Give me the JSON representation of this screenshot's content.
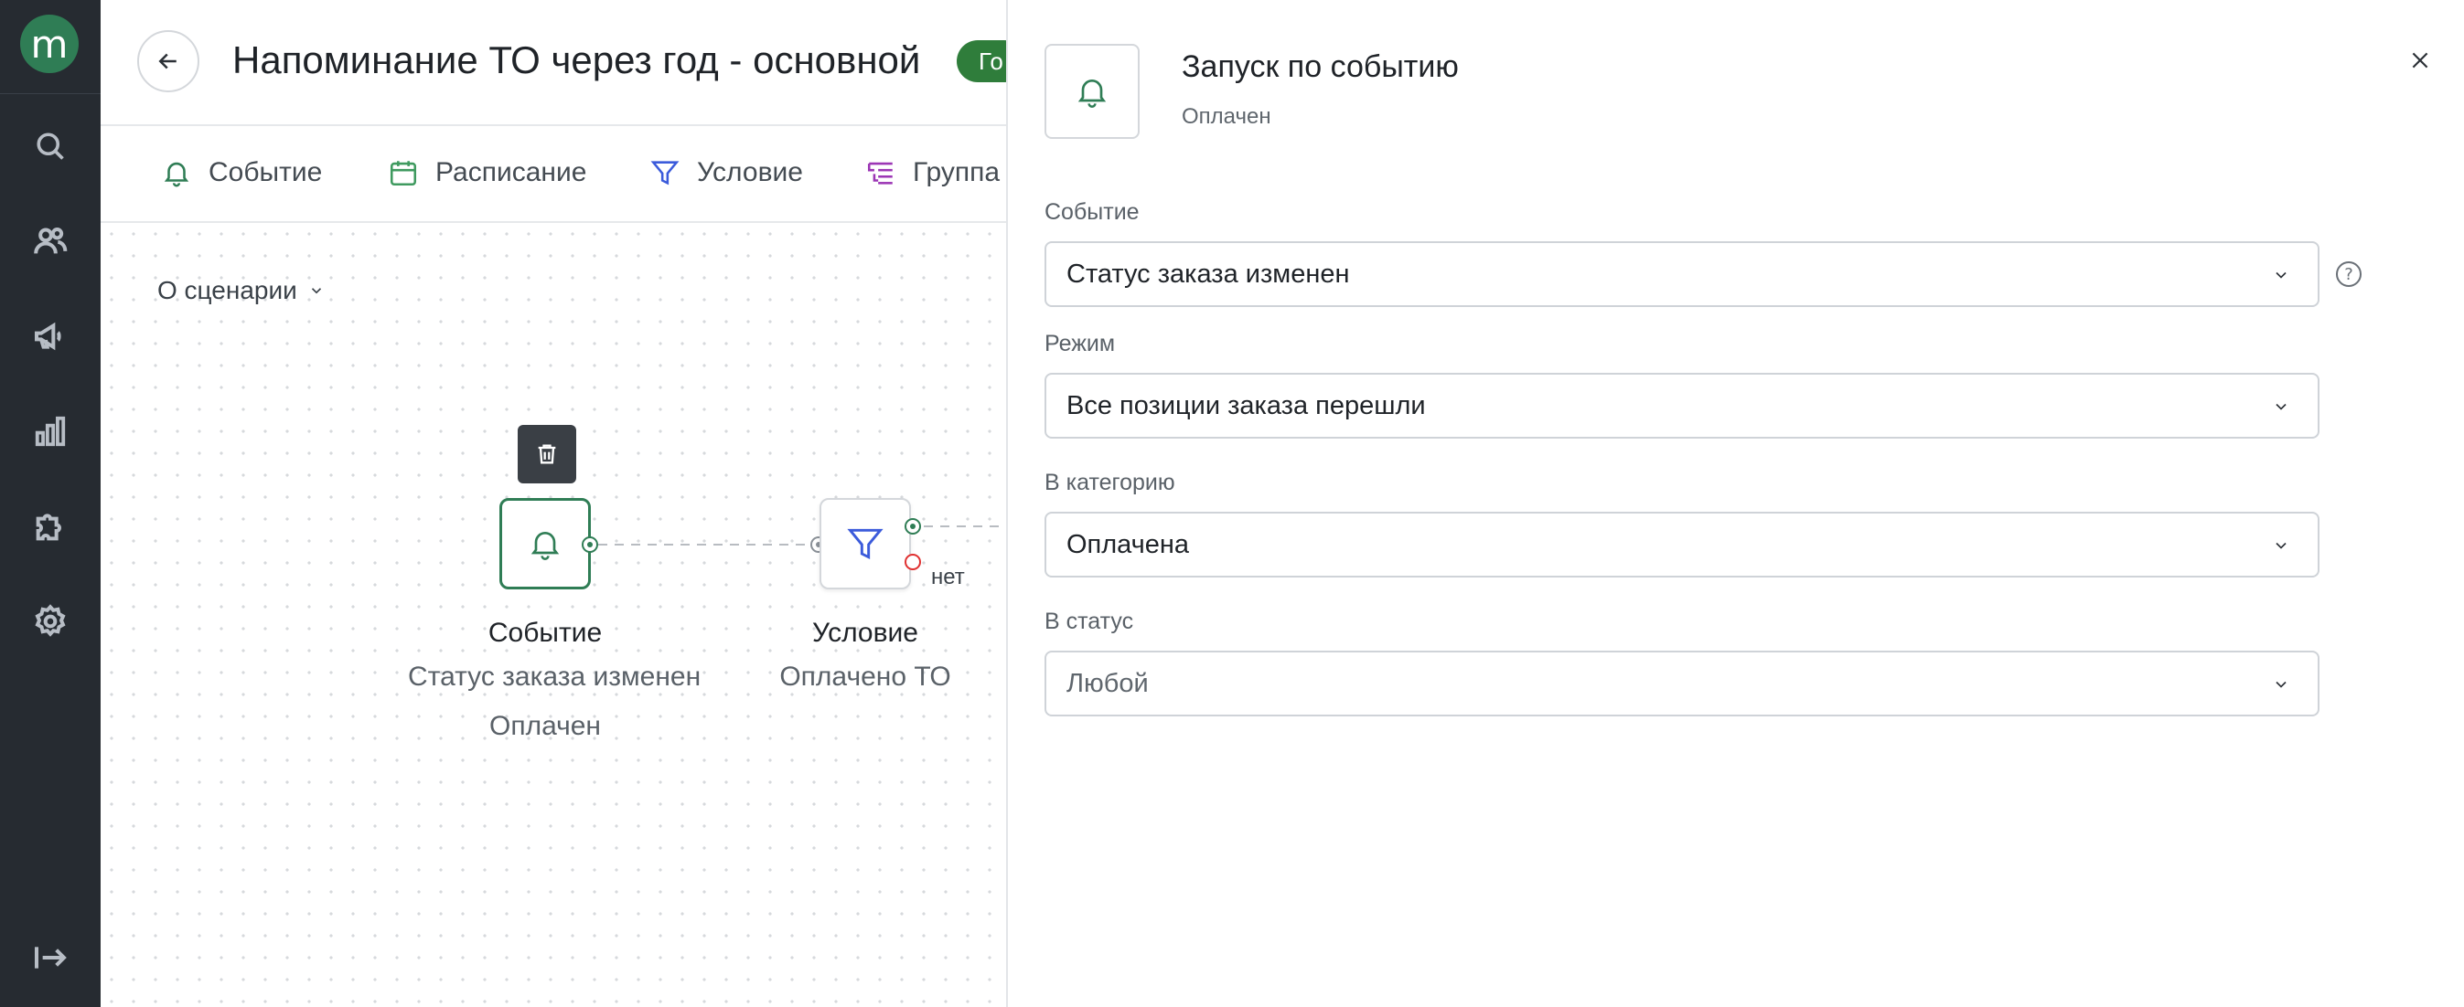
{
  "app": {
    "logo_letter": "m"
  },
  "header": {
    "title": "Напоминание ТО через год - основной",
    "status_badge": "Го"
  },
  "toolbar": {
    "items": [
      {
        "label": "Событие",
        "icon": "bell-icon"
      },
      {
        "label": "Расписание",
        "icon": "calendar-icon"
      },
      {
        "label": "Условие",
        "icon": "filter-icon"
      },
      {
        "label": "Группа",
        "icon": "group-icon"
      }
    ]
  },
  "canvas": {
    "about_label": "О сценарии",
    "nodes": [
      {
        "title": "Событие",
        "line1": "Статус заказа изменен",
        "line2": "Оплачен"
      },
      {
        "title": "Условие",
        "line1": "Оплачено ТО"
      }
    ],
    "no_branch_label": "нет"
  },
  "panel": {
    "title": "Запуск по событию",
    "subtitle": "Оплачен",
    "fields": [
      {
        "label": "Событие",
        "value": "Статус заказа изменен"
      },
      {
        "label": "Режим",
        "value": "Все позиции заказа перешли"
      },
      {
        "label": "В категорию",
        "value": "Оплачена"
      },
      {
        "label": "В статус",
        "value": "Любой"
      }
    ],
    "help_glyph": "?"
  },
  "colors": {
    "accent_green": "#2f7d55",
    "badge_green": "#2f7d3b",
    "rail_bg": "#262b31",
    "condition_blue": "#3b5bdb",
    "group_purple": "#9c36b5",
    "no_port_red": "#e03131"
  }
}
